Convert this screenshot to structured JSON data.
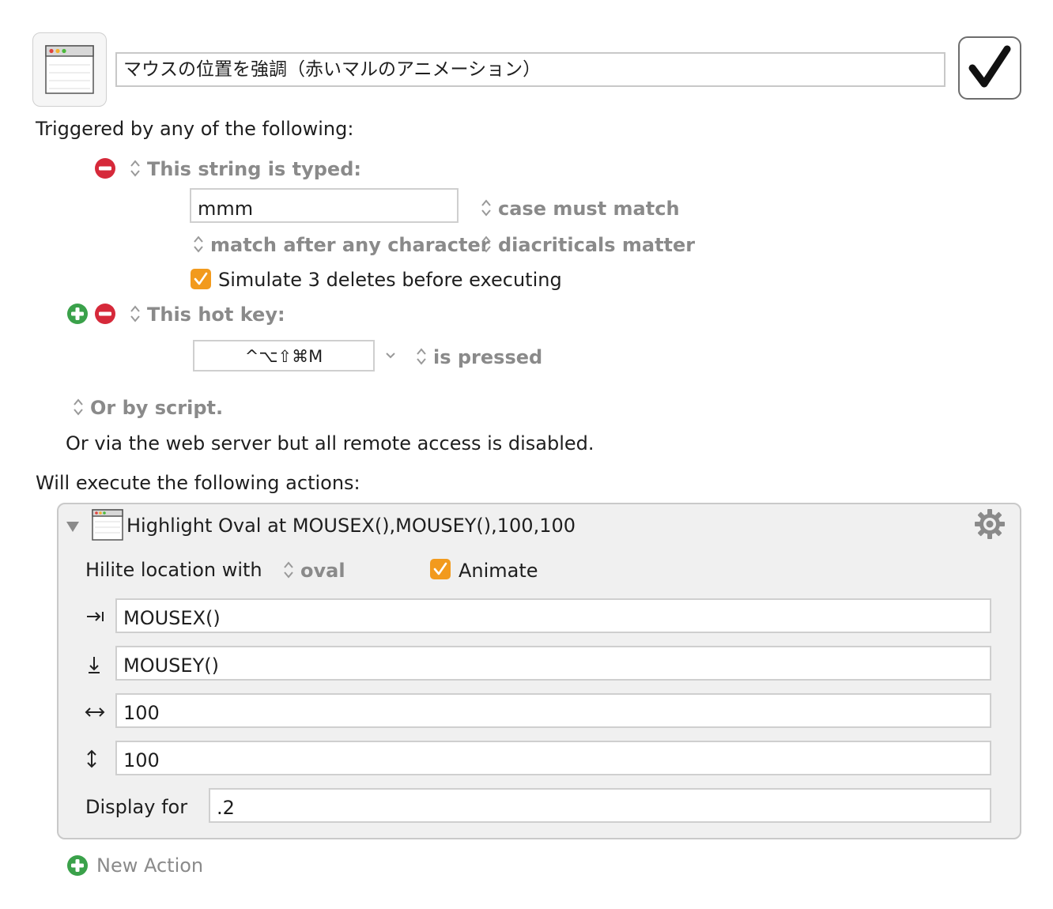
{
  "macro": {
    "name": "マウスの位置を強調（赤いマルのアニメーション）",
    "enabled": true
  },
  "triggers": {
    "heading": "Triggered by any of the following:",
    "typed_string": {
      "label": "This string is typed:",
      "value": "mmm",
      "case_option": "case must match",
      "match_option": "match after any character",
      "diacriticals_option": "diacriticals matter",
      "simulate_label": "Simulate 3 deletes before executing",
      "simulate_checked": true
    },
    "hot_key": {
      "label": "This hot key:",
      "keys": "^⌥⇧⌘M",
      "state": "is pressed"
    },
    "script_label": "Or by script.",
    "web_server_text": "Or via the web server but all remote access is disabled."
  },
  "actions": {
    "heading": "Will execute the following actions:",
    "items": [
      {
        "title": "Highlight Oval at MOUSEX(),MOUSEY(),100,100",
        "hilite_label": "Hilite location with",
        "shape": "oval",
        "animate_label": "Animate",
        "animate_checked": true,
        "x": "MOUSEX()",
        "y": "MOUSEY()",
        "width": "100",
        "height": "100",
        "display_label": "Display for",
        "display_value": ".2"
      }
    ],
    "new_action_label": "New Action"
  },
  "colors": {
    "checkbox_orange": "#f29a1d",
    "remove_red": "#d6293a",
    "add_green": "#3aa14a"
  }
}
